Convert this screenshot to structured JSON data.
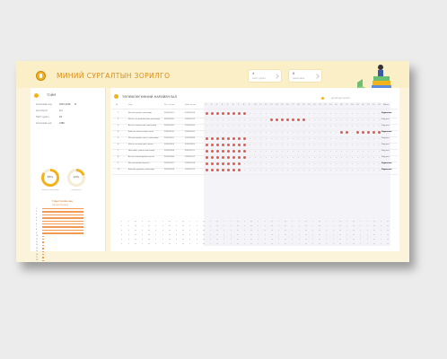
{
  "app": {
    "title": "МИНИЙ СУРГАЛТЫН ЗОРИЛГО"
  },
  "stats": [
    {
      "value": "4",
      "label": "нийт сурагч"
    },
    {
      "value": "6",
      "label": "даалгавар"
    }
  ],
  "colors": {
    "accent": "#f2b21c",
    "mark": "#e2594e",
    "bar": "#f29a52",
    "bg": "#fbf3da"
  },
  "sidebar": {
    "title": "ТОЙМ",
    "info": [
      {
        "label": "Хичээлийн нэр",
        "value": "2025-2026",
        "value2": "III"
      },
      {
        "label": "Анги бүлэг",
        "value": "4.1"
      },
      {
        "label": "Нийт сурагч",
        "value": "26"
      },
      {
        "label": "Хичээлийн цаг",
        "value": "2480"
      }
    ],
    "rings": [
      {
        "pct": "85%",
        "sub": "хийсэн даалгавар",
        "value": 0.85
      },
      {
        "pct": "20%",
        "sub": "хоцрогдол",
        "value": 0.2
      }
    ],
    "list_title": "Гүйцэтгэлийн явц",
    "list_subtitle": "Хичээл бүрээр",
    "list": [
      {
        "num": "1",
        "value": 0.95
      },
      {
        "num": "2",
        "value": 0.95
      },
      {
        "num": "3",
        "value": 0.95
      },
      {
        "num": "4",
        "value": 0.95
      },
      {
        "num": "5",
        "value": 0.95
      },
      {
        "num": "6",
        "value": 0.95
      },
      {
        "num": "7",
        "value": 0.95
      },
      {
        "num": "8",
        "value": 0.95
      },
      {
        "num": "9",
        "value": 0.95
      },
      {
        "num": "10",
        "value": 0.05
      },
      {
        "num": "11",
        "value": 0.05
      },
      {
        "num": "12",
        "value": 0.05
      },
      {
        "num": "13",
        "value": 0.05
      },
      {
        "num": "14",
        "value": 0.05
      },
      {
        "num": "15",
        "value": 0.05
      },
      {
        "num": "16",
        "value": 0.05
      },
      {
        "num": "17",
        "value": 0.05
      },
      {
        "num": "18",
        "value": 0.05
      },
      {
        "num": "19",
        "value": 0.05
      },
      {
        "num": "20",
        "value": 0.05
      }
    ]
  },
  "main": {
    "title": "ТӨЛӨВЛӨГӨӨНИЙ НАРИЙВЧЛАЛ",
    "filter": "шүүлтүүр сонгох",
    "headers": [
      "№",
      "Нэр",
      "Хүс. огноо",
      "Хийх огноо"
    ],
    "day_headers": [
      "1",
      "2",
      "3",
      "4",
      "5",
      "6",
      "7",
      "8",
      "9",
      "10",
      "11",
      "12",
      "13",
      "14",
      "15",
      "16",
      "17",
      "18",
      "19",
      "20",
      "21",
      "22",
      "23",
      "24",
      "25",
      "26",
      "27",
      "28",
      "29",
      "30",
      "31",
      "32",
      "33",
      "34"
    ],
    "status_header": "Төлөв",
    "rows": [
      {
        "num": "1",
        "name": "Математикийн даалгавар",
        "d1": "2025/09/01",
        "d2": "2025/09/08",
        "marks": [
          0,
          1,
          2,
          3,
          4,
          5,
          6,
          7
        ],
        "status": "Хэрэгжсэн",
        "active": true
      },
      {
        "num": "2",
        "name": "Монгол хэлний бичгийн даалгавар",
        "d1": "2025/09/05",
        "d2": "2025/09/12",
        "marks": [
          12,
          13,
          14,
          15,
          16,
          17,
          18
        ],
        "status": "Хийгдэж",
        "active": false
      },
      {
        "num": "3",
        "name": "Англи хэлний үгийн даалгавар",
        "d1": "2025/09/03",
        "d2": "2025/09/10",
        "marks": [],
        "status": "Хийгдэж",
        "active": false
      },
      {
        "num": "4",
        "name": "Байгаль шинжлэлийн төсөл",
        "d1": "2025/09/10",
        "d2": "2025/09/20",
        "marks": [
          25,
          26,
          28,
          29,
          30,
          31,
          32
        ],
        "status": "Хэрэгжсэн",
        "active": true
      },
      {
        "num": "5",
        "name": "Математикийн нэмэлт даалгавар",
        "d1": "2025/09/01",
        "d2": "2025/09/08",
        "marks": [
          0,
          1,
          2,
          3,
          4,
          5,
          6,
          7
        ],
        "status": "Хийгдэж",
        "active": false
      },
      {
        "num": "6",
        "name": "Монгол хэлний уран зохиол",
        "d1": "2025/09/02",
        "d2": "2025/09/09",
        "marks": [
          0,
          1,
          2,
          3,
          4,
          5,
          6,
          7
        ],
        "status": "Хийгдэж",
        "active": false
      },
      {
        "num": "7",
        "name": "Нийгмийн ухааны даалгавар",
        "d1": "2025/09/04",
        "d2": "2025/09/11",
        "marks": [
          0,
          1,
          2,
          3,
          4,
          5,
          6,
          7
        ],
        "status": "Хийгдэж",
        "active": false
      },
      {
        "num": "8",
        "name": "Англи хэлний ярианы дасгал",
        "d1": "2025/09/06",
        "d2": "2025/09/13",
        "marks": [
          0,
          1,
          2,
          3,
          4,
          5,
          6,
          7
        ],
        "status": "Хийгдэж",
        "active": false
      },
      {
        "num": "9",
        "name": "Математикийн бодлого",
        "d1": "2025/09/07",
        "d2": "2025/09/14",
        "marks": [
          0,
          1,
          2,
          3,
          4,
          5,
          6
        ],
        "status": "Хэрэгжсэн",
        "active": true
      },
      {
        "num": "10",
        "name": "Бичгийн дүрмийн даалгавар",
        "d1": "2025/09/08",
        "d2": "2025/09/15",
        "marks": [
          0,
          1,
          2,
          3,
          4,
          5,
          6
        ],
        "status": "Хэрэгжсэн",
        "active": true
      }
    ]
  }
}
